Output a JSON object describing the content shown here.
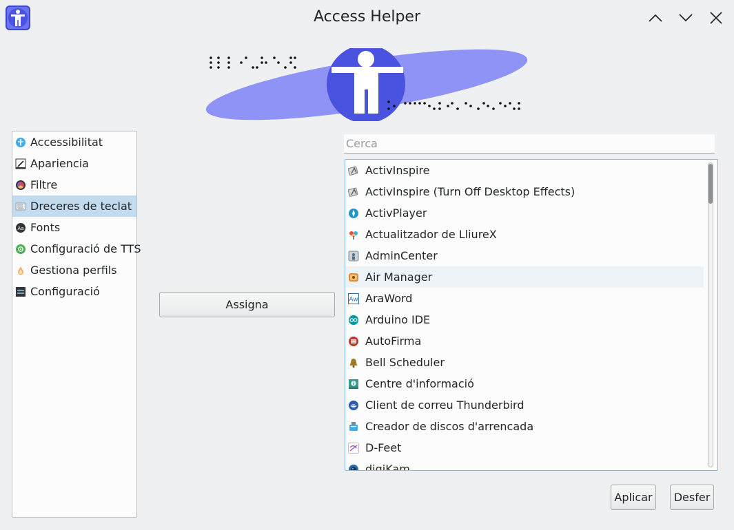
{
  "window": {
    "title": "Access Helper"
  },
  "titlebar": {
    "app_icon": "accessibility-person-icon",
    "buttons": [
      "minimize-chevron-up-icon",
      "maximize-chevron-down-icon",
      "close-x-icon"
    ]
  },
  "sidebar": {
    "items": [
      {
        "label": "Accessibilitat",
        "icon": "accessibility-icon",
        "color": "#3daee9"
      },
      {
        "label": "Apariencia",
        "icon": "appearance-pen-icon",
        "color": "#232627"
      },
      {
        "label": "Filtre",
        "icon": "color-filter-icon",
        "color": "#da4453"
      },
      {
        "label": "Dreceres de teclat",
        "icon": "keyboard-icon",
        "color": "#bcbebf"
      },
      {
        "label": "Fonts",
        "icon": "font-icon",
        "color": "#31363b"
      },
      {
        "label": "Configuració de TTS",
        "icon": "tts-icon",
        "color": "#4caf50"
      },
      {
        "label": "Gestiona perfils",
        "icon": "profile-drop-icon",
        "color": "#f6b26b"
      },
      {
        "label": "Configuració",
        "icon": "settings-panel-icon",
        "color": "#31363b"
      }
    ],
    "selected_index": 3
  },
  "actions": {
    "assign_label": "Assigna",
    "apply_label": "Aplicar",
    "undo_label": "Desfer"
  },
  "search": {
    "placeholder": "Cerca",
    "value": ""
  },
  "apps": {
    "items": [
      {
        "label": "ActivInspire",
        "icon": "activinspire-icon",
        "color": "#8a8a8a"
      },
      {
        "label": "ActivInspire (Turn Off Desktop Effects)",
        "icon": "activinspire-icon",
        "color": "#8a8a8a"
      },
      {
        "label": "ActivPlayer",
        "icon": "activplayer-icon",
        "color": "#2196c9"
      },
      {
        "label": "Actualitzador de LliureX",
        "icon": "lliurex-updater-icon",
        "color": "#e55039"
      },
      {
        "label": "AdminCenter",
        "icon": "admincenter-icon",
        "color": "#7a8a99"
      },
      {
        "label": "Air Manager",
        "icon": "air-manager-icon",
        "color": "#e08a3c"
      },
      {
        "label": "AraWord",
        "icon": "araword-icon",
        "color": "#2a6fb0"
      },
      {
        "label": "Arduino IDE",
        "icon": "arduino-icon",
        "color": "#00979c"
      },
      {
        "label": "AutoFirma",
        "icon": "autofirma-icon",
        "color": "#c0392b"
      },
      {
        "label": "Bell Scheduler",
        "icon": "bell-icon",
        "color": "#a07a2c"
      },
      {
        "label": "Centre d'informació",
        "icon": "info-centre-icon",
        "color": "#3a9a8a"
      },
      {
        "label": "Client de correu Thunderbird",
        "icon": "thunderbird-icon",
        "color": "#2a5caa"
      },
      {
        "label": "Creador de discos d'arrencada",
        "icon": "usb-creator-icon",
        "color": "#3daee9"
      },
      {
        "label": "D-Feet",
        "icon": "d-feet-icon",
        "color": "#9b59b6"
      },
      {
        "label": "digiKam",
        "icon": "digikam-icon",
        "color": "#2d6ca2"
      }
    ],
    "hover_index": 5
  }
}
